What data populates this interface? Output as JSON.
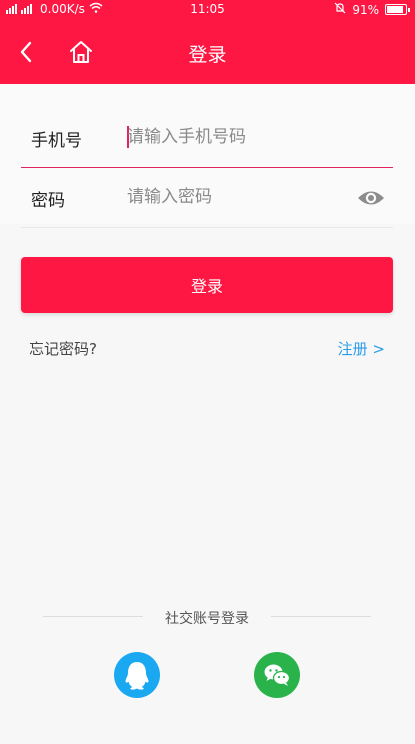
{
  "status_bar": {
    "network": "0.00K/s",
    "time": "11:05",
    "battery": "91%",
    "battery_level": 0.91
  },
  "header": {
    "title": "登录",
    "back_icon": "chevron-left-icon",
    "home_icon": "home-icon"
  },
  "form": {
    "phone_label": "手机号",
    "phone_placeholder": "请输入手机号码",
    "password_label": "密码",
    "password_placeholder": "请输入密码",
    "show_password_icon": "eye-icon"
  },
  "actions": {
    "login_label": "登录",
    "forgot_label": "忘记密码?",
    "register_label": "注册 >"
  },
  "social": {
    "title": "社交账号登录",
    "qq_icon": "qq-icon",
    "wechat_icon": "wechat-icon"
  },
  "colors": {
    "brand": "#ff1744",
    "link": "#2b9de8",
    "qq": "#1aa9f0",
    "wechat": "#2ab24b"
  }
}
